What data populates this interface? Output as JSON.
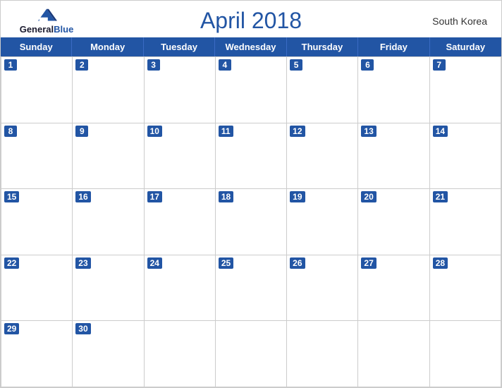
{
  "header": {
    "logo_general": "General",
    "logo_blue": "Blue",
    "title": "April 2018",
    "country": "South Korea"
  },
  "days": [
    "Sunday",
    "Monday",
    "Tuesday",
    "Wednesday",
    "Thursday",
    "Friday",
    "Saturday"
  ],
  "weeks": [
    [
      1,
      2,
      3,
      4,
      5,
      6,
      7
    ],
    [
      8,
      9,
      10,
      11,
      12,
      13,
      14
    ],
    [
      15,
      16,
      17,
      18,
      19,
      20,
      21
    ],
    [
      22,
      23,
      24,
      25,
      26,
      27,
      28
    ],
    [
      29,
      30,
      null,
      null,
      null,
      null,
      null
    ]
  ]
}
